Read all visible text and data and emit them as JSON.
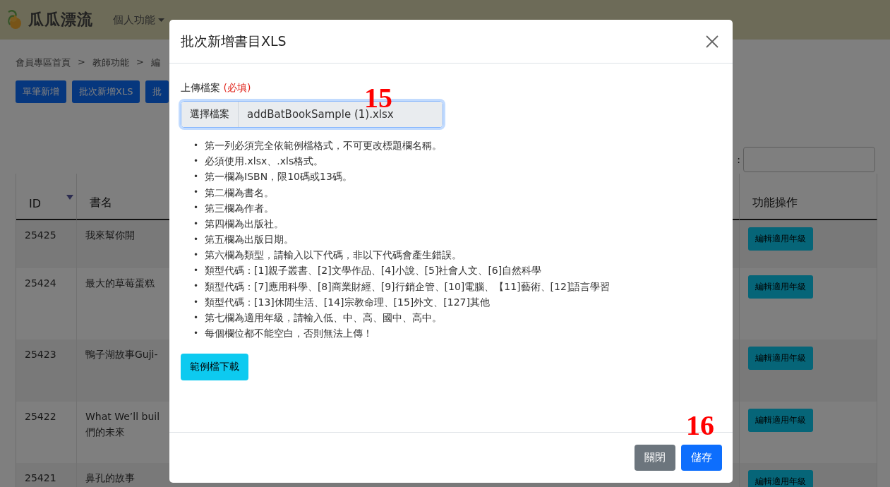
{
  "navbar": {
    "brand": "瓜瓜漂流",
    "items": [
      {
        "label": "個人功能",
        "dropdown": true
      }
    ]
  },
  "breadcrumb": {
    "separator": ">",
    "items": [
      "會員專區首頁",
      "教師功能",
      "編"
    ]
  },
  "actions": [
    "單筆新增",
    "批次新增XLS",
    "批"
  ],
  "search": {
    "label": ":"
  },
  "table": {
    "columns": [
      "ID",
      "書名",
      "功能操作"
    ],
    "rows": [
      {
        "id": "25425",
        "title": [
          "我來幫你開"
        ],
        "action": "編輯適用年級"
      },
      {
        "id": "25424",
        "title": [
          "最大的草莓蛋糕"
        ],
        "action": "編輯適用年級"
      },
      {
        "id": "25423",
        "title": [
          "鴨子湖故事Guji-"
        ],
        "action": "編輯適用年級"
      },
      {
        "id": "25422",
        "title": [
          "What We’ll buil",
          "們的未來"
        ],
        "action": "編輯適用年級"
      },
      {
        "id": "25421",
        "title": [
          "鼻孔的故事"
        ],
        "action": "編輯適用年級"
      }
    ]
  },
  "modal": {
    "title": "批次新增書目XLS",
    "field_label": "上傳檔案",
    "required": "(必填)",
    "file_button": "選擇檔案",
    "file_name": "addBatBookSample (1).xlsx",
    "bullet": "•",
    "notes": [
      "第一列必須完全依範例檔格式，不可更改標題欄名稱。",
      "必須使用.xlsx、.xls格式。",
      "第一欄為ISBN，限10碼或13碼。",
      "第二欄為書名。",
      "第三欄為作者。",
      "第四欄為出版社。",
      "第五欄為出版日期。",
      "第六欄為類型，請輸入以下代碼，非以下代碼會產生錯誤。",
      "類型代碼：[1]親子叢書、[2]文學作品、[4]小說、[5]社會人文、[6]自然科學",
      "類型代碼：[7]應用科學、[8]商業財經、[9]行銷企管、[10]電腦、【11]藝術、[12]語言學習",
      "類型代碼：[13]休閒生活、[14]宗教命理、[15]外文、[127]其他",
      "第七欄為適用年級，請輸入低、中、高、國中、高中。",
      "每個欄位都不能空白，否則無法上傳！"
    ],
    "download_button": "範例檔下載",
    "footer_buttons": [
      {
        "label": "關閉",
        "kind": "secondary"
      },
      {
        "label": "儲存",
        "kind": "primary"
      }
    ]
  },
  "annotations": [
    "15",
    "16"
  ]
}
